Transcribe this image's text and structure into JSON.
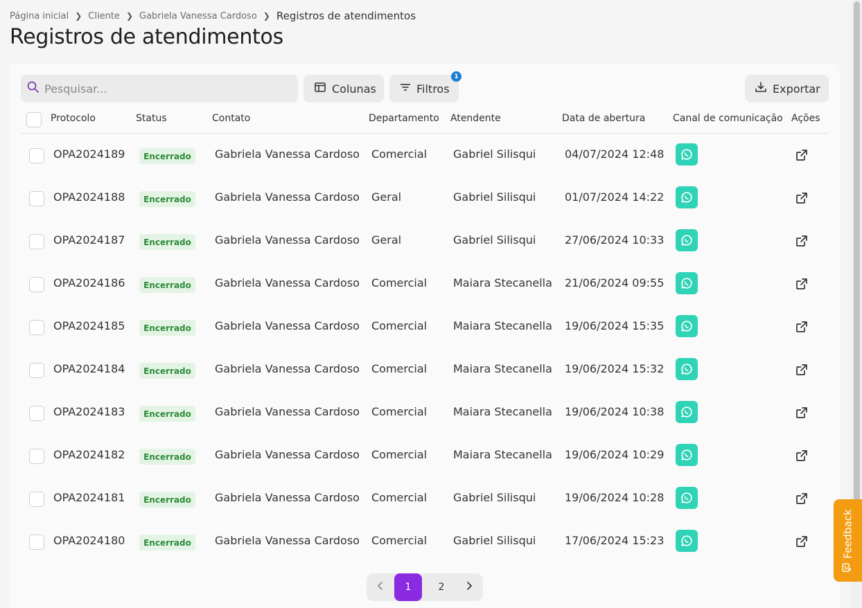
{
  "breadcrumb": {
    "items": [
      "Página inicial",
      "Cliente",
      "Gabriela Vanessa Cardoso"
    ],
    "current": "Registros de atendimentos"
  },
  "page_title": "Registros de atendimentos",
  "toolbar": {
    "search_placeholder": "Pesquisar...",
    "columns_label": "Colunas",
    "filters_label": "Filtros",
    "filters_badge": "1",
    "export_label": "Exportar"
  },
  "table": {
    "headers": [
      "Protocolo",
      "Status",
      "Contato",
      "Departamento",
      "Atendente",
      "Data de abertura",
      "Canal de comunicação",
      "Ações"
    ],
    "rows": [
      {
        "protocol": "OPA2024189",
        "status": "Encerrado",
        "contact": "Gabriela Vanessa Cardoso",
        "department": "Comercial",
        "agent": "Gabriel Silisqui",
        "opened": "04/07/2024 12:48"
      },
      {
        "protocol": "OPA2024188",
        "status": "Encerrado",
        "contact": "Gabriela Vanessa Cardoso",
        "department": "Geral",
        "agent": "Gabriel Silisqui",
        "opened": "01/07/2024 14:22"
      },
      {
        "protocol": "OPA2024187",
        "status": "Encerrado",
        "contact": "Gabriela Vanessa Cardoso",
        "department": "Geral",
        "agent": "Gabriel Silisqui",
        "opened": "27/06/2024 10:33"
      },
      {
        "protocol": "OPA2024186",
        "status": "Encerrado",
        "contact": "Gabriela Vanessa Cardoso",
        "department": "Comercial",
        "agent": "Maiara Stecanella",
        "opened": "21/06/2024 09:55"
      },
      {
        "protocol": "OPA2024185",
        "status": "Encerrado",
        "contact": "Gabriela Vanessa Cardoso",
        "department": "Comercial",
        "agent": "Maiara Stecanella",
        "opened": "19/06/2024 15:35"
      },
      {
        "protocol": "OPA2024184",
        "status": "Encerrado",
        "contact": "Gabriela Vanessa Cardoso",
        "department": "Comercial",
        "agent": "Maiara Stecanella",
        "opened": "19/06/2024 15:32"
      },
      {
        "protocol": "OPA2024183",
        "status": "Encerrado",
        "contact": "Gabriela Vanessa Cardoso",
        "department": "Comercial",
        "agent": "Maiara Stecanella",
        "opened": "19/06/2024 10:38"
      },
      {
        "protocol": "OPA2024182",
        "status": "Encerrado",
        "contact": "Gabriela Vanessa Cardoso",
        "department": "Comercial",
        "agent": "Maiara Stecanella",
        "opened": "19/06/2024 10:29"
      },
      {
        "protocol": "OPA2024181",
        "status": "Encerrado",
        "contact": "Gabriela Vanessa Cardoso",
        "department": "Comercial",
        "agent": "Gabriel Silisqui",
        "opened": "19/06/2024 10:28"
      },
      {
        "protocol": "OPA2024180",
        "status": "Encerrado",
        "contact": "Gabriela Vanessa Cardoso",
        "department": "Comercial",
        "agent": "Gabriel Silisqui",
        "opened": "17/06/2024 15:23"
      }
    ]
  },
  "pagination": {
    "pages": [
      "1",
      "2"
    ],
    "current": "1"
  },
  "feedback_label": "Feedback",
  "colors": {
    "accent": "#8a2be2",
    "channel": "#2fd3b6",
    "status_bg": "#e4f4e4",
    "status_text": "#2e8b3a",
    "feedback": "#f39c12",
    "badge": "#1c7fd6"
  },
  "icons": {
    "search": "search-icon",
    "columns": "columns-icon",
    "filters": "filter-icon",
    "export": "download-icon",
    "channel": "whatsapp-icon",
    "action": "external-link-icon",
    "prev": "chevron-left-icon",
    "next": "chevron-right-icon",
    "feedback": "message-icon"
  }
}
